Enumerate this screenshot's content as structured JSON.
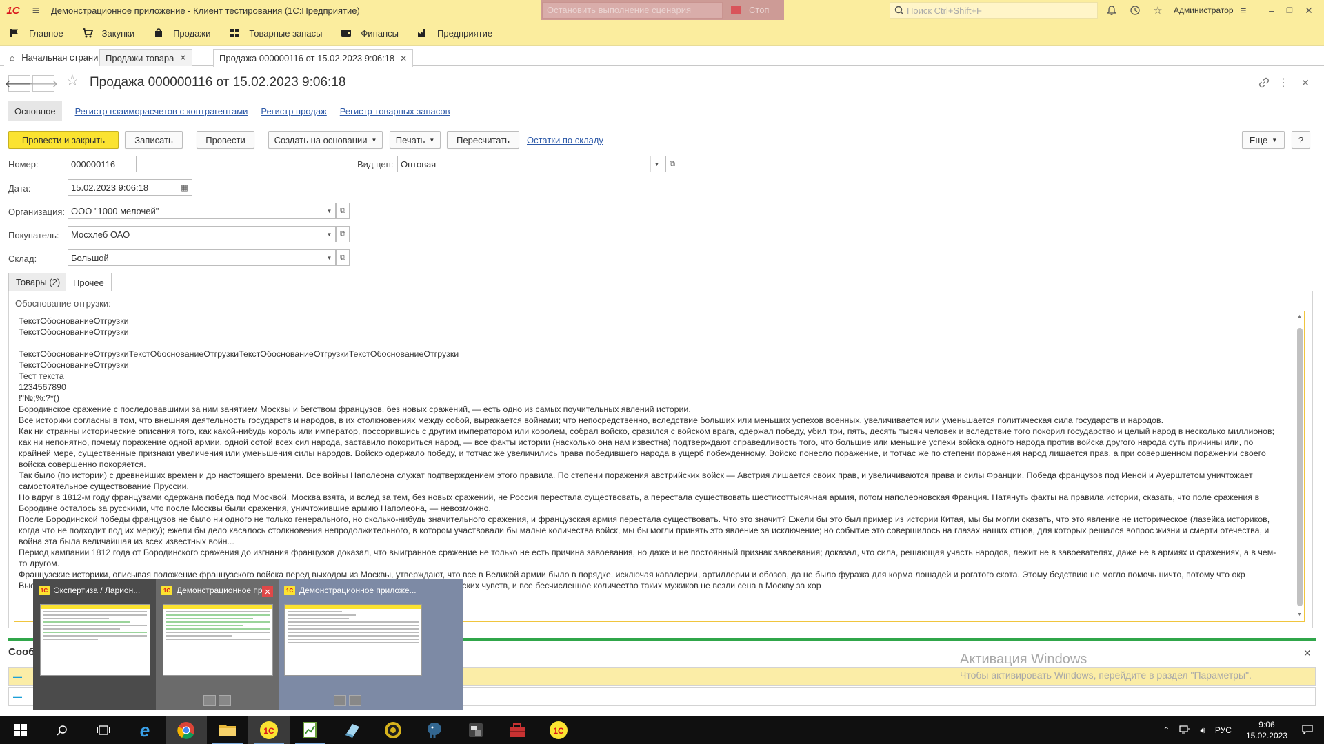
{
  "titlebar": {
    "logo": "1C",
    "app_title": "Демонстрационное приложение  - Клиент тестирования (1С:Предприятие)",
    "scenario_stop_placeholder": "Остановить выполнение сценария",
    "stop_label": "Стоп",
    "search_placeholder": "Поиск Ctrl+Shift+F",
    "user": "Администратор"
  },
  "sections": [
    "Главное",
    "Закупки",
    "Продажи",
    "Товарные запасы",
    "Финансы",
    "Предприятие"
  ],
  "open_tabs": [
    {
      "label": "Начальная страница"
    },
    {
      "label": "Продажи товара"
    },
    {
      "label": "Продажа 000000116 от 15.02.2023 9:06:18"
    }
  ],
  "form": {
    "title": "Продажа 000000116 от 15.02.2023 9:06:18",
    "nav": {
      "main": "Основное",
      "links": [
        "Регистр взаиморасчетов с контрагентами",
        "Регистр продаж",
        "Регистр товарных запасов"
      ]
    },
    "commands": {
      "post_close": "Провести и закрыть",
      "save": "Записать",
      "post": "Провести",
      "create_based": "Создать на основании",
      "print": "Печать",
      "recalc": "Пересчитать",
      "stock_link": "Остатки по складу",
      "more": "Еще",
      "help": "?"
    },
    "fields": {
      "number_label": "Номер:",
      "number": "000000116",
      "date_label": "Дата:",
      "date": "15.02.2023  9:06:18",
      "price_type_label": "Вид цен:",
      "price_type": "Оптовая",
      "org_label": "Организация:",
      "org": "ООО \"1000 мелочей\"",
      "buyer_label": "Покупатель:",
      "buyer": "Мосхлеб ОАО",
      "warehouse_label": "Склад:",
      "warehouse": "Большой"
    },
    "page_tabs": [
      "Товары (2)",
      "Прочее"
    ],
    "reason_label": "Обоснование отгрузки:",
    "reason_text": "ТекстОбоснованиеОтгрузки\nТекстОбоснованиеОтгрузки\n\nТекстОбоснованиеОтгрузкиТекстОбоснованиеОтгрузкиТекстОбоснованиеОтгрузкиТекстОбоснованиеОтгрузки\nТекстОбоснованиеОтгрузки\nТест текста\n1234567890\n!\"№;%:?*()\nБородинское сражение с последовавшими за ним занятием Москвы и бегством французов, без новых сражений, — есть одно из самых поучительных явлений истории.\nВсе историки согласны в том, что внешняя деятельность государств и народов, в их столкновениях между собой, выражается войнами; что непосредственно, вследствие больших или меньших успехов военных, увеличивается или уменьшается политическая сила государств и народов.\nКак ни странны исторические описания того, как какой-нибудь король или император, поссорившись с другим императором или королем, собрал войско, сразился с войском врага, одержал победу, убил три, пять, десять тысяч человек и вследствие того покорил государство и целый народ в несколько миллионов; как ни непонятно, почему поражение одной армии, одной сотой всех сил народа, заставило покориться народ, — все факты истории (насколько она нам известна) подтверждают справедливость того, что большие или меньшие успехи войска одного народа против войска другого народа суть причины или, по крайней мере, существенные признаки увеличения или уменьшения силы народов. Войско одержало победу, и тотчас же увеличились права победившего народа в ущерб побежденному. Войско понесло поражение, и тотчас же по степени поражения народ лишается прав, а при совершенном поражении своего войска совершенно покоряется.\nТак было (по истории) с древнейших времен и до настоящего времени. Все войны Наполеона служат подтверждением этого правила. По степени поражения австрийских войск — Австрия лишается своих прав, и увеличиваются права и силы Франции. Победа французов под Иеной и Ауерштетом уничтожает самостоятельное существование Пруссии.\nНо вдруг в 1812-м году французами одержана победа под Москвой. Москва взята, и вслед за тем, без новых сражений, не Россия перестала существовать, а перестала существовать шестисоттысячная армия, потом наполеоновская Франция. Натянуть факты на правила истории, сказать, что поле сражения в Бородине осталось за русскими, что после Москвы были сражения, уничтожившие армию Наполеона, — невозможно.\nПосле Бородинской победы французов не было ни одного не только генерального, но сколько-нибудь значительного сражения, и французская армия перестала существовать. Что это значит? Ежели бы это был пример из истории Китая, мы бы могли сказать, что это явление не историческое (лазейка историков, когда что не подходит под их мерку); ежели бы дело касалось столкновения непродолжительного, в котором участвовали бы малые количества войск, мы бы могли принять это явление за исключение; но событие это совершилось на глазах наших отцов, для которых решался вопрос жизни и смерти отечества, и война эта была величайшая из всех известных войн...\nПериод кампании 1812 года от Бородинского сражения до изгнания французов доказал, что выигранное сражение не только не есть причина завоевания, но даже и не постоянный признак завоевания; доказал, что сила, решающая участь народов, лежит не в завоевателях, даже не в армиях и сражениях, а в чем-то другом.\nФранцузские историки, описывая положение французского войска перед выходом из Москвы, утверждают, что все в Великой армии было в порядке, исключая кавалерии, артиллерии и обозов, да не было фуража для корма лошадей и рогатого скота. Этому бедствию не могло помочь ничто, потому что окр\nВыступления французов приехали в Москву с подводами грабить город и вообще не высказывали лично геройских чувств, и все бесчисленное количество таких мужиков не везли сена в Москву за хор"
  },
  "messages": {
    "title": "Сообщения:"
  },
  "watermark": {
    "line1": "Активация Windows",
    "line2": "Чтобы активировать Windows, перейдите в раздел \"Параметры\"."
  },
  "thumbnails": [
    {
      "title": "Экспертиза / Ларион..."
    },
    {
      "title": "Демонстрационное при..."
    },
    {
      "title": "Демонстрационное приложе..."
    }
  ],
  "tray": {
    "lang": "РУС",
    "time": "9:06",
    "date": "15.02.2023"
  },
  "colors": {
    "accent": "#fbe331",
    "titlebar": "#fbed9e",
    "link": "#2e5aa8",
    "focus_border": "#f0c53e",
    "messages_line": "#30a64a"
  }
}
